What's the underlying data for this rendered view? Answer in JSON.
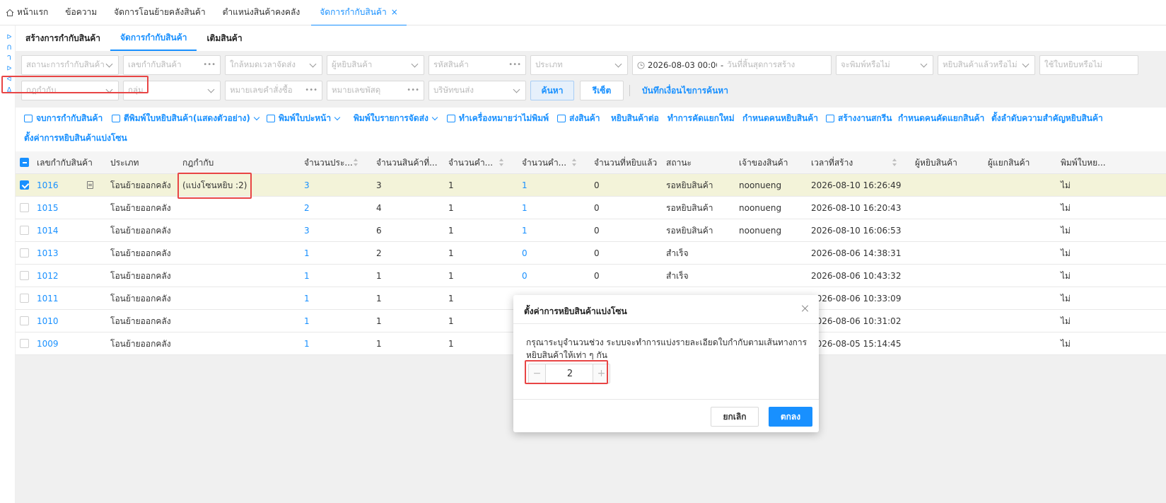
{
  "top_tabs": [
    {
      "label": "หน้าแรก"
    },
    {
      "label": "ข้อความ"
    },
    {
      "label": "จัดการโอนย้ายคลังสินค้า"
    },
    {
      "label": "ตำแหน่งสินค้าคงคลัง"
    },
    {
      "label": "จัดการกำกับสินค้า",
      "close": "×"
    }
  ],
  "left_rail": {
    "text": "ᐅ ᑎ ᒉ ᐅ ᐊ ᐃ"
  },
  "sub_tabs": [
    {
      "label": "สร้างการกำกับสินค้า"
    },
    {
      "label": "จัดการกำกับสินค้า"
    },
    {
      "label": "เติมสินค้า"
    }
  ],
  "filters": {
    "row1": [
      {
        "placeholder": "สถานะการกำกับสินค้า"
      },
      {
        "placeholder": "เลขกำกับสินค้า"
      },
      {
        "placeholder": "ใกล้หมดเวลาจัดส่ง"
      },
      {
        "placeholder": "ผู้หยิบสินค้า"
      },
      {
        "placeholder": "รหัสสินค้า"
      },
      {
        "placeholder": "ประเภท"
      },
      {
        "value": "2026-08-03 00:00:0",
        "separator": "-",
        "placeholder_end": "วันที่สิ้นสุดการสร้าง"
      },
      {
        "placeholder": "จะพิมพ์หรือไม่"
      },
      {
        "placeholder": "หยิบสินค้าแล้วหรือไม่"
      },
      {
        "placeholder": "ใช้ใบหยิบหรือไม่"
      }
    ],
    "row2": [
      {
        "placeholder": "กฎกำกับ"
      },
      {
        "placeholder": "กลุ่ม"
      },
      {
        "placeholder": "หมายเลขคำสั่งซื้อ"
      },
      {
        "placeholder": "หมายเลขพัสดุ"
      },
      {
        "placeholder": "บริษัทขนส่ง"
      }
    ],
    "search_label": "ค้นหา",
    "reset_label": "รีเซ็ต",
    "save_condition_label": "บันทึกเงื่อนไขการค้นหา"
  },
  "toolbar": {
    "items": [
      {
        "label": "จบการกำกับสินค้า",
        "icon": "complete-icon"
      },
      {
        "label": "ตีพิมพ์ใบหยิบสินค้า(แสดงตัวอย่าง)",
        "icon": "printer-icon",
        "dropdown": true
      },
      {
        "label": "พิมพ์ใบปะหน้า",
        "icon": "printer-icon",
        "dropdown": true
      },
      {
        "label": "พิมพ์ใบรายการจัดส่ง",
        "dropdown": true
      },
      {
        "label": "ทำเครื่องหมายว่าไม่พิมพ์",
        "icon": "printer-icon"
      },
      {
        "label": "ส่งสินค้า",
        "icon": "truck-icon"
      },
      {
        "label": "หยิบสินค้าต่อ"
      },
      {
        "label": "ทำการคัดแยกใหม่"
      },
      {
        "label": "กำหนดคนหยิบสินค้า"
      },
      {
        "label": "สร้างงานสกรีน",
        "icon": "screen-icon"
      },
      {
        "label": "กำหนดคนคัดแยกสินค้า"
      },
      {
        "label": "ตั้งลำดับความสำคัญหยิบสินค้า"
      },
      {
        "label": "ตั้งค่าการหยิบสินค้าแบ่งโซน"
      }
    ]
  },
  "table": {
    "headers": [
      "เลขกำกับสินค้า",
      "ประเภท",
      "กฎกำกับ",
      "จำนวนประ...",
      "จำนวนสินค้าที่...",
      "จำนวนคำ...",
      "จำนวนคำ...",
      "จำนวนที่หยิบแล้ว",
      "สถานะ",
      "เจ้าของสินค้า",
      "เวลาที่สร้าง",
      "ผู้หยิบสินค้า",
      "ผู้แยกสินค้า",
      "พิมพ์ใบหย..."
    ],
    "rows": [
      {
        "id": "1016",
        "type": "โอนย้ายออกคลัง",
        "rule": "(แบ่งโซนหยิบ :2)",
        "c1": "3",
        "c2": "3",
        "c3": "1",
        "c4": "1",
        "picked": "0",
        "status": "รอหยิบสินค้า",
        "owner": "noonueng",
        "created": "2026-08-10 16:26:49",
        "picker": "",
        "sorter": "",
        "printed": "ไม่",
        "selected": true
      },
      {
        "id": "1015",
        "type": "โอนย้ายออกคลัง",
        "rule": "",
        "c1": "2",
        "c2": "4",
        "c3": "1",
        "c4": "1",
        "picked": "0",
        "status": "รอหยิบสินค้า",
        "owner": "noonueng",
        "created": "2026-08-10 16:20:43",
        "picker": "",
        "sorter": "",
        "printed": "ไม่",
        "selected": false
      },
      {
        "id": "1014",
        "type": "โอนย้ายออกคลัง",
        "rule": "",
        "c1": "3",
        "c2": "6",
        "c3": "1",
        "c4": "1",
        "picked": "0",
        "status": "รอหยิบสินค้า",
        "owner": "noonueng",
        "created": "2026-08-10 16:06:53",
        "picker": "",
        "sorter": "",
        "printed": "ไม่",
        "selected": false
      },
      {
        "id": "1013",
        "type": "โอนย้ายออกคลัง",
        "rule": "",
        "c1": "1",
        "c2": "2",
        "c3": "1",
        "c4": "0",
        "picked": "0",
        "status": "สำเร็จ",
        "owner": "",
        "created": "2026-08-06 14:38:31",
        "picker": "",
        "sorter": "",
        "printed": "ไม่",
        "selected": false
      },
      {
        "id": "1012",
        "type": "โอนย้ายออกคลัง",
        "rule": "",
        "c1": "1",
        "c2": "1",
        "c3": "1",
        "c4": "0",
        "picked": "0",
        "status": "สำเร็จ",
        "owner": "",
        "created": "2026-08-06 10:43:32",
        "picker": "",
        "sorter": "",
        "printed": "ไม่",
        "selected": false
      },
      {
        "id": "1011",
        "type": "โอนย้ายออกคลัง",
        "rule": "",
        "c1": "1",
        "c2": "1",
        "c3": "1",
        "c4": "",
        "picked": "",
        "status": "",
        "owner": "",
        "created": "2026-08-06 10:33:09",
        "picker": "",
        "sorter": "",
        "printed": "ไม่",
        "selected": false
      },
      {
        "id": "1010",
        "type": "โอนย้ายออกคลัง",
        "rule": "",
        "c1": "1",
        "c2": "1",
        "c3": "1",
        "c4": "",
        "picked": "",
        "status": "",
        "owner": "",
        "created": "2026-08-06 10:31:02",
        "picker": "",
        "sorter": "",
        "printed": "ไม่",
        "selected": false
      },
      {
        "id": "1009",
        "type": "โอนย้ายออกคลัง",
        "rule": "",
        "c1": "1",
        "c2": "1",
        "c3": "1",
        "c4": "",
        "picked": "",
        "status": "",
        "owner": "",
        "created": "2026-08-05 15:14:45",
        "picker": "",
        "sorter": "",
        "printed": "ไม่",
        "selected": false
      }
    ]
  },
  "dialog": {
    "title": "ตั้งค่าการหยิบสินค้าแบ่งโซน",
    "message": "กรุณาระบุจำนวนช่วง ระบบจะทำการแบ่งรายละเอียดใบกำกับตามเส้นทางการหยิบสินค้าให้เท่า ๆ กัน",
    "stepper_value": "2",
    "minus": "−",
    "plus": "+",
    "cancel_label": "ยกเลิก",
    "ok_label": "ตกลง"
  },
  "colors": {
    "accent": "#1890ff",
    "highlight_row": "#f3f3d9",
    "annotation_red": "#e84545"
  }
}
